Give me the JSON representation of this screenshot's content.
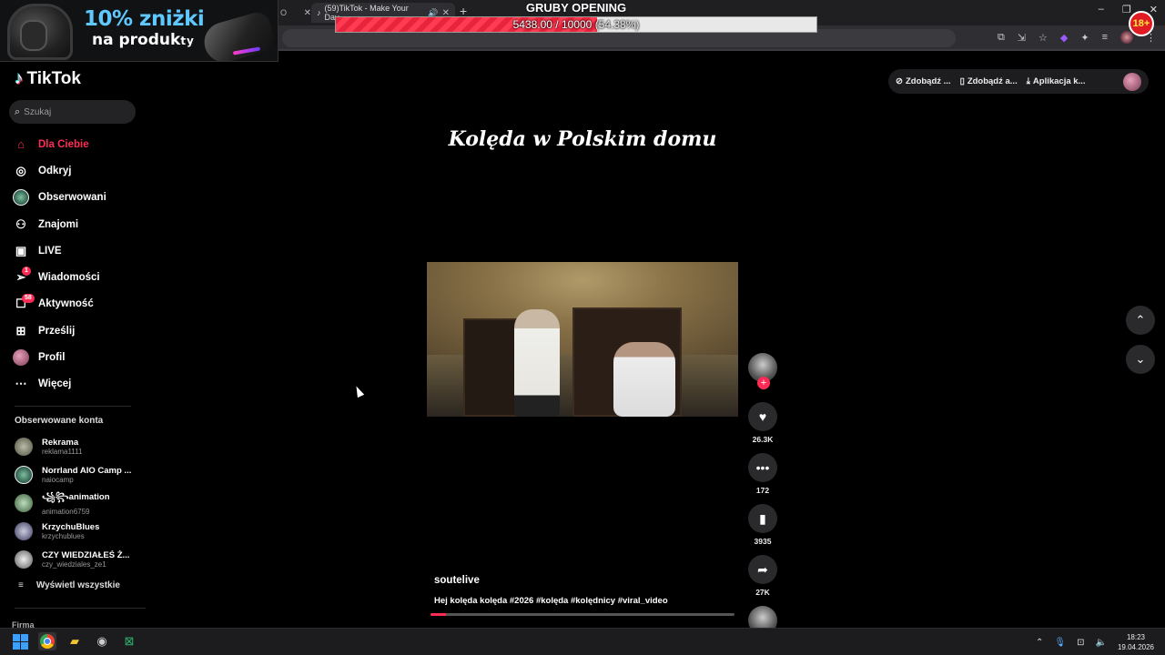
{
  "browser": {
    "prev_tab_label": "O",
    "active_tab_label": "(59)TikTok - Make Your Day",
    "new_tab": "+",
    "window_controls": [
      "–",
      "❐",
      "✕"
    ]
  },
  "stream_overlay": {
    "ad_line1": "10% zniżki",
    "ad_line2": "na produk",
    "ad_line2_small": "ty",
    "goal_title": "GRUBY OPENING",
    "goal_current": 5438,
    "goal_target": 10000,
    "goal_fraction": 0.5438,
    "goal_amount_text": "5438.00 / 10000",
    "goal_percent_text": "(54.38%)",
    "age_badge": "18+"
  },
  "tiktok": {
    "logo": "TikTok",
    "search_placeholder": "Szukaj",
    "nav": [
      {
        "label": "Dla Ciebie",
        "icon": "home-icon",
        "active": true
      },
      {
        "label": "Odkryj",
        "icon": "compass-icon"
      },
      {
        "label": "Obserwowani",
        "icon": "following-avatar-icon"
      },
      {
        "label": "Znajomi",
        "icon": "friends-icon"
      },
      {
        "label": "LIVE",
        "icon": "live-icon"
      },
      {
        "label": "Wiadomości",
        "icon": "messages-icon",
        "badge": "1"
      },
      {
        "label": "Aktywność",
        "icon": "activity-icon",
        "badge": "58"
      },
      {
        "label": "Prześlij",
        "icon": "upload-icon"
      },
      {
        "label": "Profil",
        "icon": "profile-avatar-icon"
      },
      {
        "label": "Więcej",
        "icon": "more-icon"
      }
    ],
    "followed_title": "Obserwowane konta",
    "accounts": [
      {
        "name": "Rekrama",
        "handle": "reklama1111"
      },
      {
        "name": "Norrland AIO Camp ...",
        "handle": "naiocamp"
      },
      {
        "name": "꧁꧂animation",
        "handle": "animation6759"
      },
      {
        "name": "KrzychuBlues",
        "handle": "krzychublues"
      },
      {
        "name": "CZY WIEDZIAŁEŚ Ż...",
        "handle": "czy_wiedziales_ze1"
      }
    ],
    "show_all": "Wyświetl wszystkie",
    "firma": "Firma",
    "top_buttons": [
      "Zdobądź ...",
      "Zdobądź a...",
      "Aplikacja k..."
    ],
    "video": {
      "title": "Kolęda w Polskim domu",
      "author": "soutelive",
      "description": "Hej kolęda kolęda #2026 #kolęda #kolędnicy #viral_video",
      "progress": 0.05,
      "likes": "26.3K",
      "comments": "172",
      "saves": "3935",
      "shares": "27K"
    }
  },
  "taskbar": {
    "time": "18:23",
    "date": "19.04.2026"
  }
}
